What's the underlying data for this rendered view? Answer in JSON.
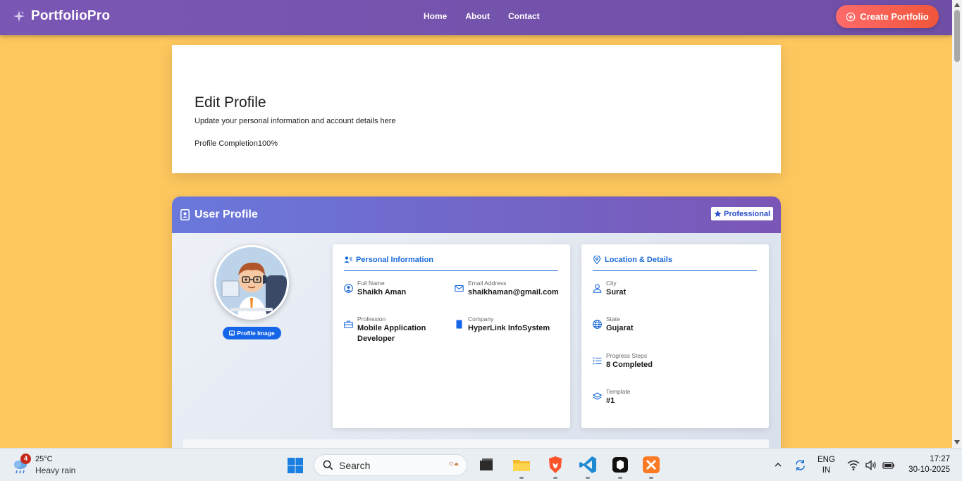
{
  "navbar": {
    "brand": "PortfolioPro",
    "links": [
      "Home",
      "About",
      "Contact"
    ],
    "create_button": "Create Portfolio"
  },
  "header": {
    "title": "Edit Profile",
    "subtitle": "Update your personal information and account details here",
    "completion": "Profile Completion100%"
  },
  "profile": {
    "title": "User Profile",
    "badge": "Professional",
    "image_button": "Profile Image",
    "personal": {
      "title": "Personal Information",
      "full_name_label": "Full Name",
      "full_name": "Shaikh Aman",
      "email_label": "Email Address",
      "email": "shaikhaman@gmail.com",
      "profession_label": "Profession",
      "profession": "Mobile Application Developer",
      "company_label": "Company",
      "company": "HyperLink InfoSystem"
    },
    "location": {
      "title": "Location & Details",
      "city_label": "City",
      "city": "Surat",
      "state_label": "State",
      "state": "Gujarat",
      "progress_label": "Progress Steps",
      "progress": "8 Completed",
      "template_label": "Template",
      "template": "#1"
    }
  },
  "taskbar": {
    "weather_badge": "4",
    "temperature": "25°C",
    "weather": "Heavy rain",
    "search_placeholder": "Search",
    "language": "ENG",
    "region": "IN",
    "time": "17:27",
    "date": "30-10-2025"
  },
  "colors": {
    "page_bg": "#fdc75e",
    "navbar": "#7a57b4",
    "create_button": "#f0553a",
    "accent_blue": "#1868d8",
    "image_button": "#1565e8"
  }
}
